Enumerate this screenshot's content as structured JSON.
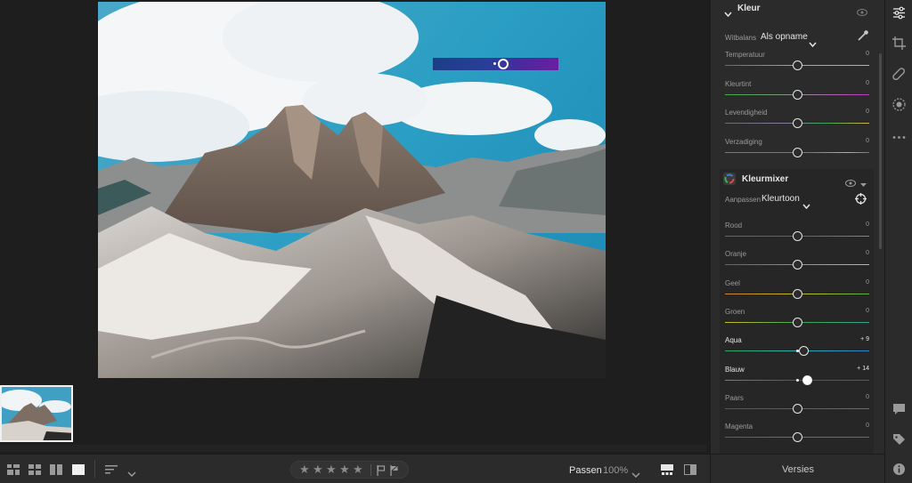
{
  "floating_slider": {
    "value_fraction": 0.55
  },
  "toolbar": {
    "fit_label": "Passen",
    "zoom_label": "100%",
    "rating_stars": 5,
    "flag_icons": [
      "flag-pick-icon",
      "flag-reject-icon"
    ]
  },
  "panel": {
    "color_section": {
      "title": "Kleur",
      "wb_label": "Witbalans",
      "wb_value": "Als opname",
      "sliders": [
        {
          "label": "Temperatuur",
          "value": "0",
          "pos": 0.5
        },
        {
          "label": "Kleurtint",
          "value": "0",
          "pos": 0.5
        },
        {
          "label": "Levendigheid",
          "value": "0",
          "pos": 0.5
        },
        {
          "label": "Verzadiging",
          "value": "0",
          "pos": 0.5
        }
      ]
    },
    "mixer_section": {
      "title": "Kleurmixer",
      "adjust_label": "Aanpassen",
      "adjust_value": "Kleurtoon",
      "sliders": [
        {
          "label": "Rood",
          "value": "0",
          "pos": 0.5,
          "active": false
        },
        {
          "label": "Oranje",
          "value": "0",
          "pos": 0.5,
          "active": false
        },
        {
          "label": "Geel",
          "value": "0",
          "pos": 0.5,
          "active": false
        },
        {
          "label": "Groen",
          "value": "0",
          "pos": 0.5,
          "active": false
        },
        {
          "label": "Aqua",
          "value": "+ 9",
          "pos": 0.545,
          "active": true
        },
        {
          "label": "Blauw",
          "value": "+ 14",
          "pos": 0.57,
          "active": true
        },
        {
          "label": "Paars",
          "value": "0",
          "pos": 0.5,
          "active": false
        },
        {
          "label": "Magenta",
          "value": "0",
          "pos": 0.5,
          "active": false
        }
      ]
    },
    "versions_label": "Versies"
  },
  "rail_icons": [
    "edit-sliders-icon",
    "crop-icon",
    "healing-icon",
    "mask-icon",
    "more-icon",
    "comment-icon",
    "tag-icon",
    "info-icon"
  ],
  "colors": {
    "accent_text": "#e6e6e6",
    "panel_bg": "#2b2b2b",
    "canvas_bg": "#1e1e1e"
  }
}
